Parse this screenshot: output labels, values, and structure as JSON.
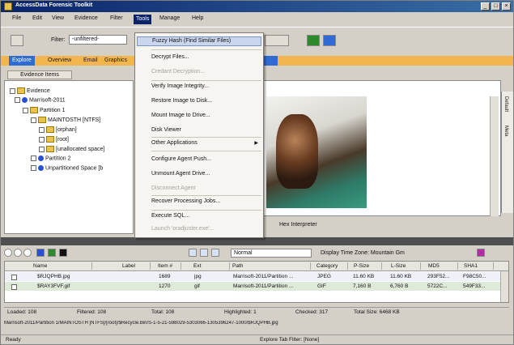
{
  "window": {
    "title": "AccessData Forensic Toolkit"
  },
  "menubar": {
    "items": [
      "File",
      "Edit",
      "View",
      "Evidence",
      "Filter",
      "Tools",
      "Manage",
      "Help"
    ],
    "active": "Tools"
  },
  "toolbar": {
    "filter_label": "Filter:",
    "filter_value": "-unfiltered-"
  },
  "tabs": [
    "Explore",
    "Overview",
    "Email",
    "Graphics"
  ],
  "tree": {
    "tab_label": "Evidence Items",
    "nodes": [
      "Evidence",
      "Marrisoft-2011",
      "Partition 1",
      "MAINTOSTH [NTFS]",
      "[orphan]",
      "[root]",
      "[unallocated space]",
      "Partition 2",
      "Unpartitioned Space [b"
    ]
  },
  "tools_menu": {
    "items": [
      {
        "label": "Fuzzy Hash (Find Similar Files)",
        "disabled": false,
        "highlighted": true
      },
      {
        "label": "Decrypt Files...",
        "disabled": false
      },
      {
        "label": "Credant Decryption...",
        "disabled": true
      },
      {
        "label": "Verify Image Integrity...",
        "disabled": false
      },
      {
        "label": "Restore Image to Disk...",
        "disabled": false
      },
      {
        "label": "Mount Image to Drive...",
        "disabled": false
      },
      {
        "label": "Disk Viewer",
        "disabled": false
      },
      {
        "label": "Other Applications",
        "disabled": false,
        "submenu": true
      },
      {
        "label": "Configure Agent Push...",
        "disabled": false
      },
      {
        "label": "Unmount Agent Drive...",
        "disabled": false
      },
      {
        "label": "Disconnect Agent",
        "disabled": true
      },
      {
        "label": "Recover Processing Jobs...",
        "disabled": false
      },
      {
        "label": "Execute SQL...",
        "disabled": false
      },
      {
        "label": "Launch 'oradjuster.exe'...",
        "disabled": true
      }
    ]
  },
  "viewer": {
    "tab_hex": "Hex Interpreter",
    "side_tabs": [
      "Default",
      "Meta"
    ]
  },
  "file_toolbar": {
    "mode": "Normal",
    "timezone": "Display Time Zone: Mountain Gm"
  },
  "grid": {
    "headers": [
      "Name",
      "Label",
      "Item #",
      "Ext",
      "Path",
      "Category",
      "P-Size",
      "L-Size",
      "MD5",
      "SHA1"
    ],
    "rows": [
      [
        "$RJQPHB.jpg",
        "",
        "1689",
        "jpg",
        "Marrisoft-2011/Partition ...",
        "JPEG",
        "11.60 KB",
        "11.60 KB",
        "293F52...",
        "F98C50..."
      ],
      [
        "$RAY3FVF.gif",
        "",
        "1270",
        "gif",
        "Marrisoft-2011/Partition ...",
        "GIF",
        "7,160 B",
        "6,760 B",
        "5722C...",
        "549F33..."
      ]
    ]
  },
  "status": {
    "loaded": "Loaded: 108",
    "filtered": "Filtered: 108",
    "total": "Total: 108",
    "highlighted": "Highlighted: 1",
    "checked": "Checked: 317",
    "total_size": "Total Size: 6468 KB"
  },
  "path_line": "Marrisoft-2011/Partition 1/MAINTOSTH [NTFS]/[root]/$Recycle.Bin/S-1-5-21-598029-5303066-1305396247-1000/$RJQPHB.jpg",
  "bottom_status": {
    "left": "Ready",
    "right": "Explore Tab Filter: [None]"
  },
  "colors": {
    "title_bar": "#0a246a",
    "tab_strip": "#f2b64f",
    "active_tab": "#2f6bd0",
    "menu_highlight": "#c9d6ee"
  }
}
